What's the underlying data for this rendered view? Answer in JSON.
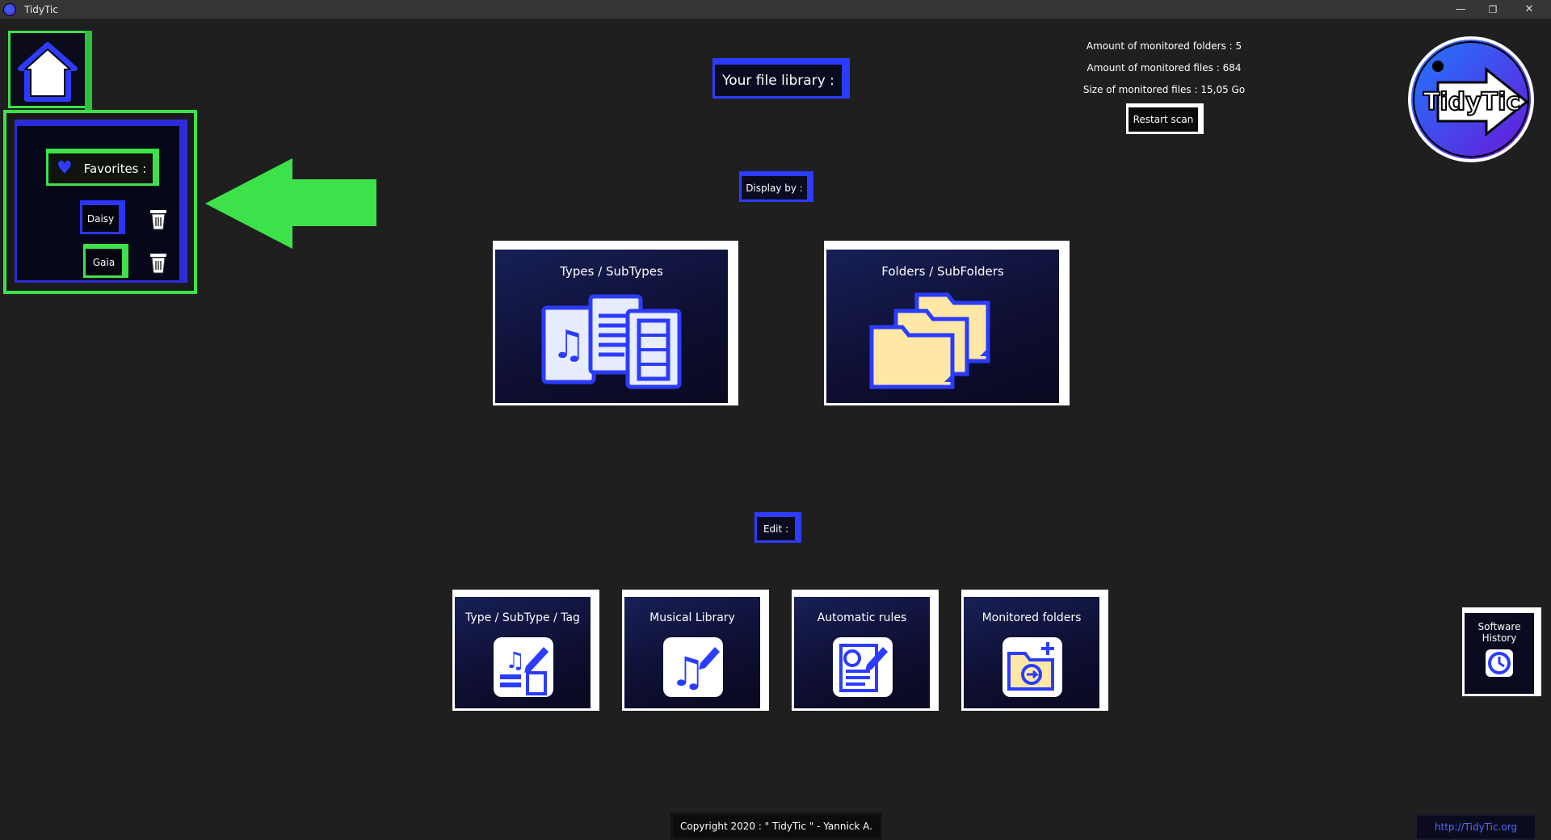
{
  "window": {
    "title": "TidyTic",
    "minimize": "—",
    "restore": "❐",
    "close": "✕"
  },
  "favorites": {
    "title": "Favorites :",
    "items": [
      {
        "label": "Daisy"
      },
      {
        "label": "Gaia"
      }
    ]
  },
  "library": {
    "title": "Your file library :"
  },
  "stats": {
    "folders": "Amount of monitored folders : 5",
    "files": "Amount of monitored files : 684",
    "size": "Size of monitored files : 15,05 Go",
    "restart_label": "Restart scan"
  },
  "logo": {
    "text": "TidyTic"
  },
  "display_by": {
    "label": "Display by :",
    "options": [
      {
        "label": "Types / SubTypes"
      },
      {
        "label": "Folders / SubFolders"
      }
    ]
  },
  "edit": {
    "label": "Edit :",
    "options": [
      {
        "label": "Type / SubType / Tag"
      },
      {
        "label": "Musical Library"
      },
      {
        "label": "Automatic rules"
      },
      {
        "label": "Monitored folders"
      }
    ]
  },
  "history": {
    "line1": "Software",
    "line2": "History"
  },
  "footer": {
    "copyright": "Copyright 2020 : \" TidyTic \" - Yannick A.",
    "url": "http://TidyTic.org"
  },
  "colors": {
    "accent_green": "#3de24a",
    "accent_blue": "#2c3cff",
    "background": "#1f1f1f"
  },
  "icons": [
    "home-icon",
    "heart-icon",
    "trash-icon",
    "arrow-left-icon",
    "files-icon",
    "folders-icon",
    "edit-tag-icon",
    "music-icon",
    "rules-icon",
    "monitored-folder-icon",
    "clock-icon"
  ]
}
